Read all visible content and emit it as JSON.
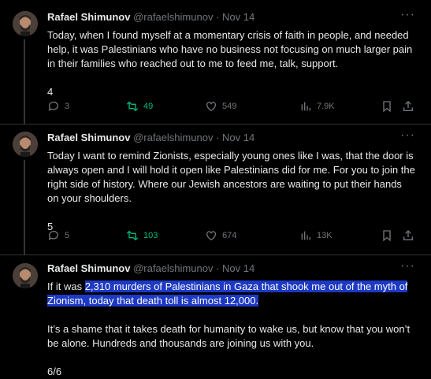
{
  "tweets": [
    {
      "author_name": "Rafael Shimunov",
      "handle": "@rafaelshimunov",
      "separator": "·",
      "date": "Nov 14",
      "more": "···",
      "text": "Today, when I found myself at a momentary crisis of faith in people, and needed help, it was Palestinians who have no business not focusing on much larger pain in their families who reached out to me to feed me, talk, support.",
      "count_label": "4",
      "replies": "3",
      "retweets": "49",
      "likes": "549",
      "views": "7.9K"
    },
    {
      "author_name": "Rafael Shimunov",
      "handle": "@rafaelshimunov",
      "separator": "·",
      "date": "Nov 14",
      "more": "···",
      "text": "Today I want to remind Zionists, especially young ones like I was, that the door is always open and I will hold it open like Palestinians did for me. For you to join the right side of history. Where our Jewish ancestors are waiting to put their hands on your shoulders.",
      "count_label": "5",
      "replies": "5",
      "retweets": "103",
      "likes": "674",
      "views": "13K"
    },
    {
      "author_name": "Rafael Shimunov",
      "handle": "@rafaelshimunov",
      "separator": "·",
      "date": "Nov 14",
      "more": "···",
      "text_prefix": "If it was ",
      "text_highlighted": "2,310 murders of Palestinians in Gaza that shook me out of the myth of Zionism, today that death toll is almost 12,000.",
      "text_second": "It’s a shame that it takes death for humanity to wake us, but know that you won’t be alone. Hundreds and thousands are joining us with you.",
      "count_label": "6/6"
    }
  ],
  "colors": {
    "background": "#000000",
    "text": "#e7e9ea",
    "muted": "#71767b",
    "retweet": "#00ba7c",
    "highlight": "#1d39c4"
  },
  "icons": {
    "reply": "reply-icon",
    "retweet": "retweet-icon",
    "like": "heart-icon",
    "views": "views-icon",
    "bookmark": "bookmark-icon",
    "share": "share-icon",
    "more": "more-icon"
  }
}
